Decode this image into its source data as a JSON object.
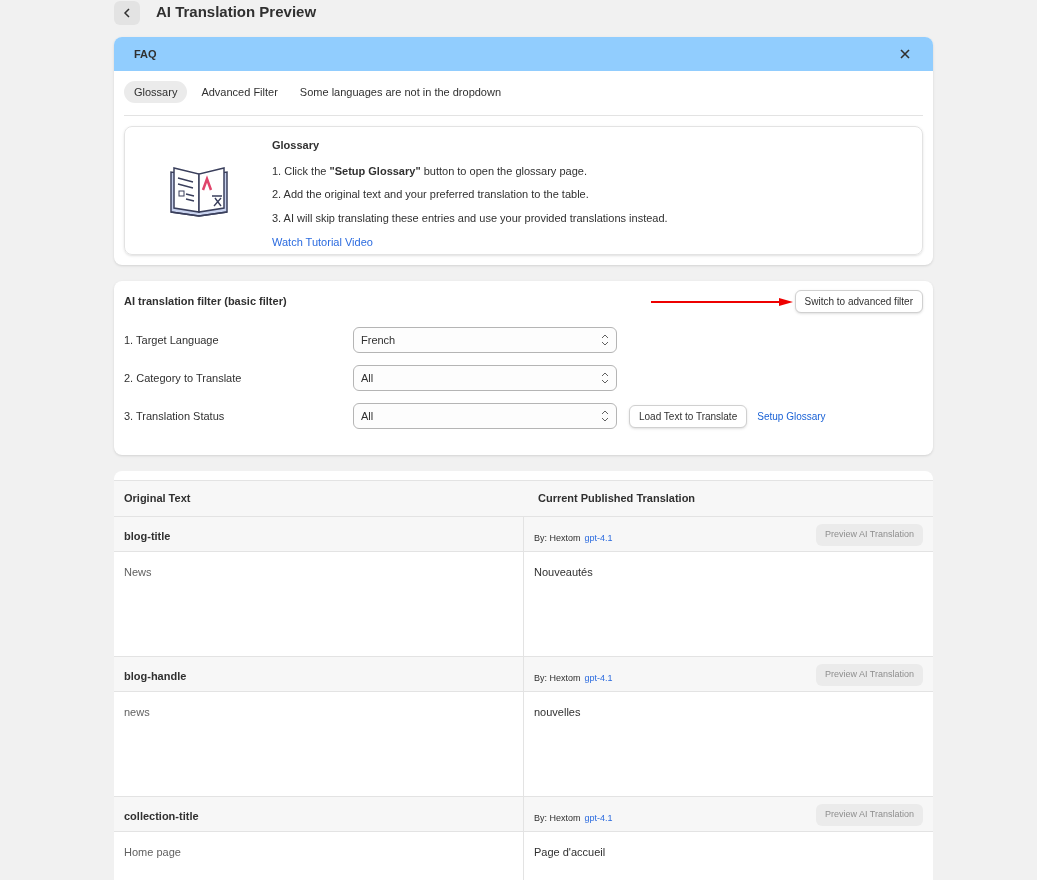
{
  "page": {
    "title": "AI Translation Preview"
  },
  "faq": {
    "title": "FAQ",
    "tabs": [
      {
        "label": "Glossary",
        "selected": true
      },
      {
        "label": "Advanced Filter",
        "selected": false
      },
      {
        "label": "Some languages are not in the dropdown",
        "selected": false
      }
    ],
    "card": {
      "heading": "Glossary",
      "steps": [
        "1. Click the **\"Setup Glossary\"** button to open the glossary page.",
        "2. Add the original text and your preferred translation to the table.",
        "3. AI will skip translating these entries and use your provided translations instead."
      ],
      "link": "Watch Tutorial Video"
    }
  },
  "filter": {
    "title": "AI translation filter (basic filter)",
    "switch_button": "Switch to advanced filter",
    "fields": [
      {
        "label": "1. Target Language",
        "value": "French"
      },
      {
        "label": "2. Category to Translate",
        "value": "All"
      },
      {
        "label": "3. Translation Status",
        "value": "All"
      }
    ],
    "load_button": "Load Text to Translate",
    "glossary_link": "Setup Glossary"
  },
  "table": {
    "columns": [
      "Original Text",
      "Current Published Translation"
    ],
    "rows": [
      {
        "key": "blog-title",
        "by": "By: Hextom",
        "model": "gpt-4.1",
        "button": "Preview AI Translation",
        "disabled": true,
        "original": "News",
        "translation": "Nouveautés"
      },
      {
        "key": "blog-handle",
        "by": "By: Hextom",
        "model": "gpt-4.1",
        "button": "Preview AI Translation",
        "disabled": true,
        "original": "news",
        "translation": "nouvelles"
      },
      {
        "key": "collection-title",
        "by": "By: Hextom",
        "model": "gpt-4.1",
        "button": "Preview AI Translation",
        "disabled": true,
        "original": "Home page",
        "translation": "Page d'accueil"
      }
    ]
  }
}
